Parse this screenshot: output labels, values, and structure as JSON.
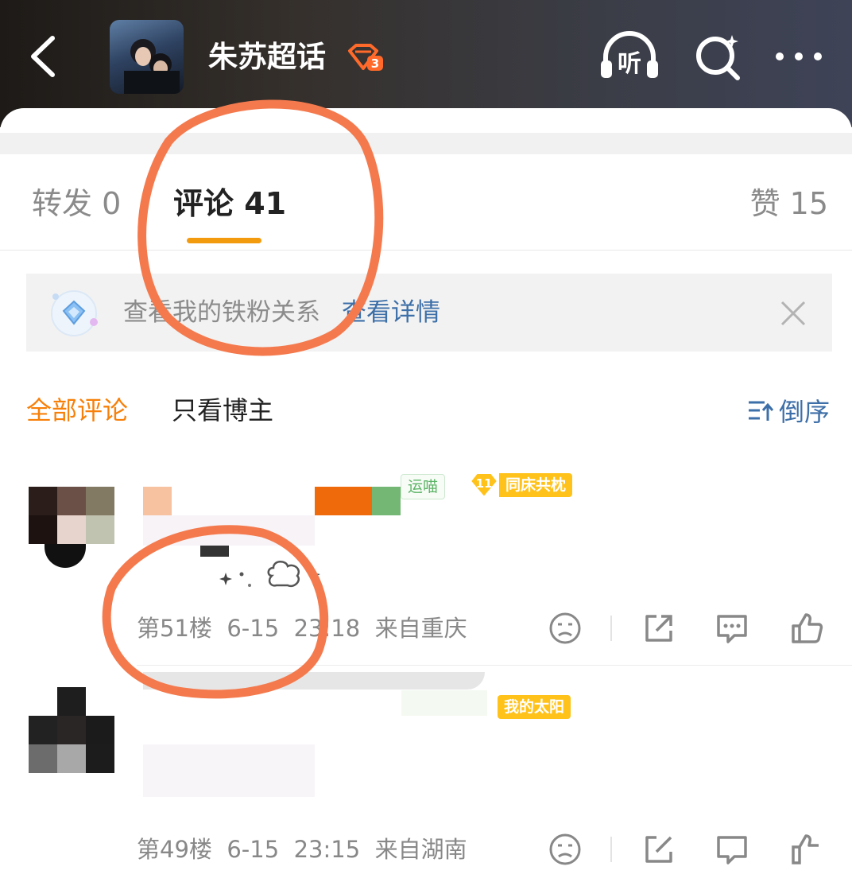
{
  "header": {
    "back_icon": "chevron-left-icon",
    "title": "朱苏超话",
    "level_badge": "3",
    "listen_label": "听",
    "search_icon": "search-sparkle-icon",
    "more_icon": "more-dots-icon"
  },
  "tabs": {
    "repost": "转发 0",
    "comments": "评论 41",
    "likes": "赞 15",
    "active_color": "#f39b0f"
  },
  "fan_banner": {
    "text": "查看我的铁粉关系",
    "link": "查看详情",
    "close_icon": "close-icon"
  },
  "filters": {
    "all": "全部评论",
    "blogger_only": "只看博主",
    "sort": "倒序"
  },
  "comments": [
    {
      "badges": [
        "运喵",
        "11",
        "同床共枕"
      ],
      "meta": "第51楼  6-15  23:18  来自重庆"
    },
    {
      "badges": [
        "我的太阳"
      ],
      "meta": "第49楼  6-15  23:15  来自湖南"
    }
  ],
  "colors": {
    "accent_orange": "#f7800a",
    "link_blue": "#3d6fa8",
    "annotation": "#f47a4e"
  }
}
